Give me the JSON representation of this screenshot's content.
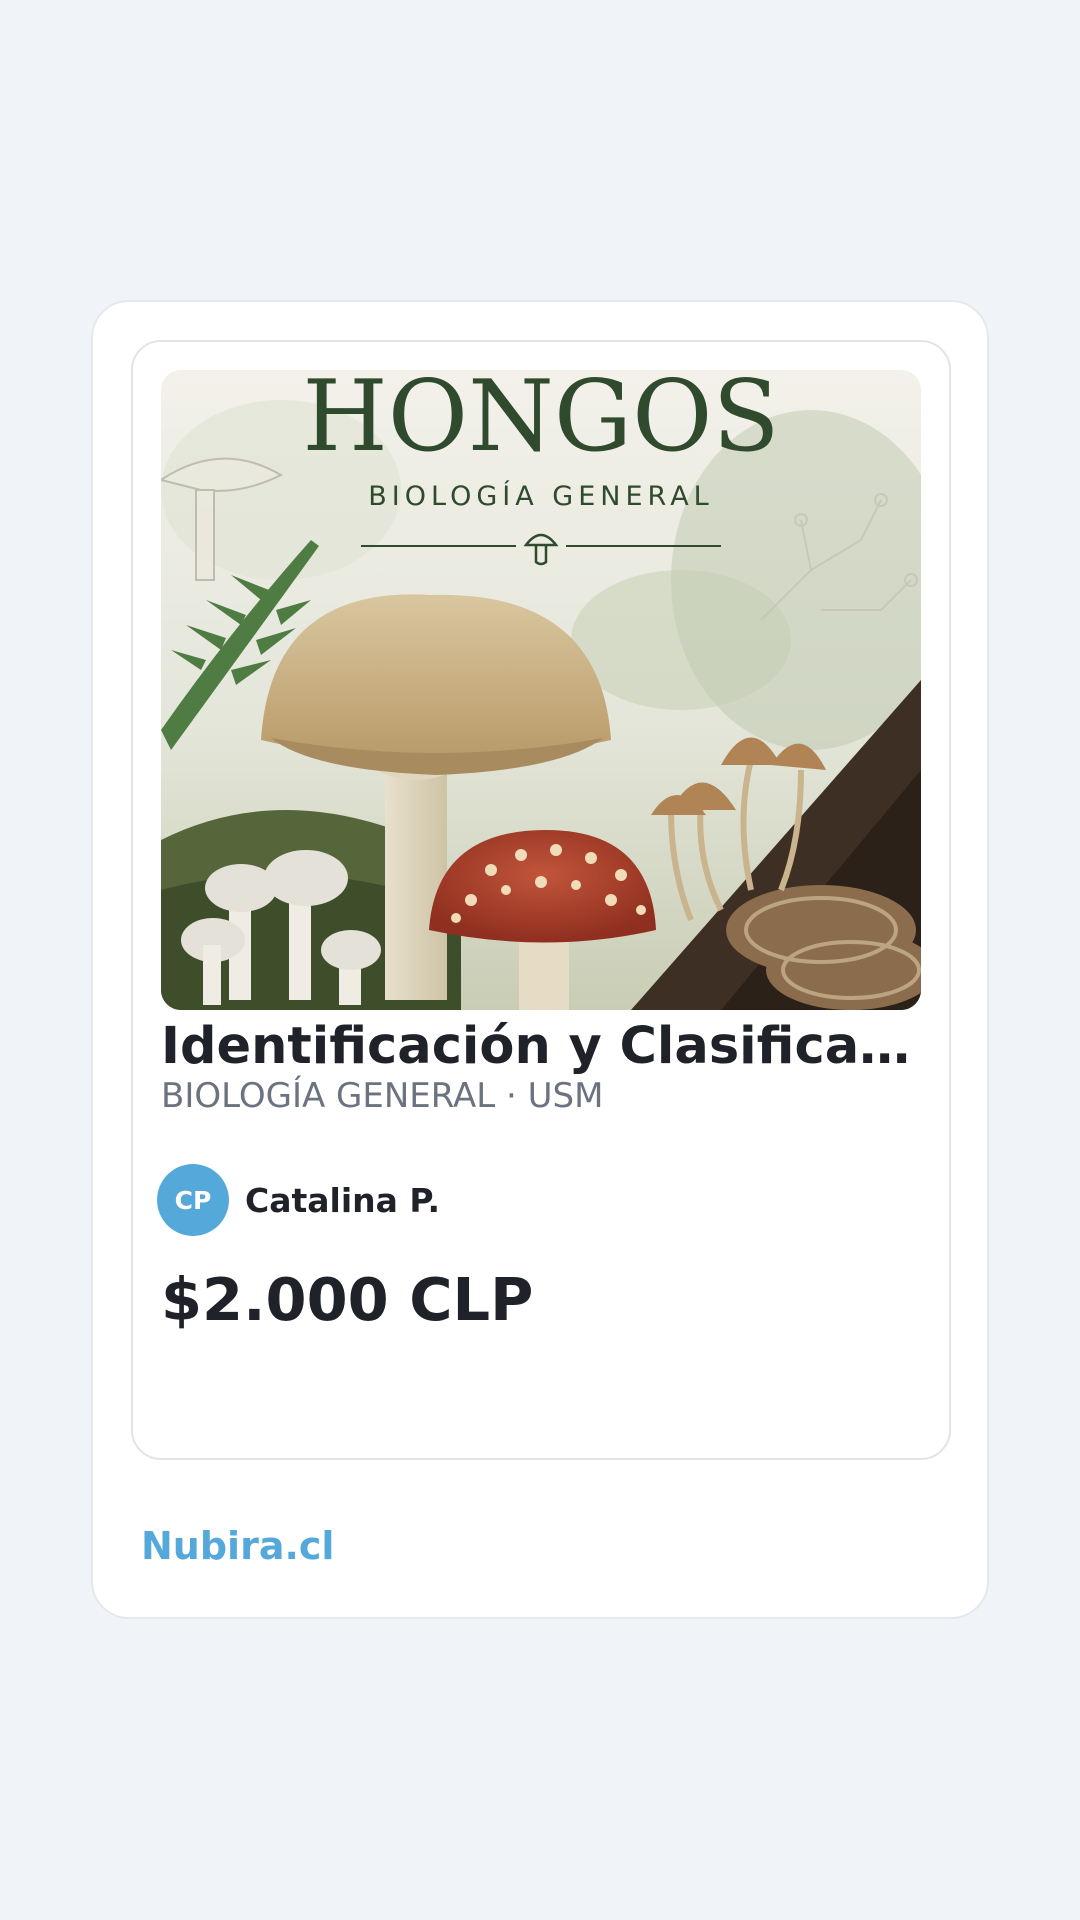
{
  "cover": {
    "title": "HONGOS",
    "subtitle": "BIOLOGÍA GENERAL"
  },
  "product": {
    "title": "Identificación y Clasificación...",
    "meta": "BIOLOGÍA GENERAL · USM",
    "price": "$2.000 CLP"
  },
  "seller": {
    "initials": "CP",
    "name": "Catalina P."
  },
  "brand": {
    "label": "Nubira.cl"
  },
  "colors": {
    "background": "#f0f4f8",
    "accent": "#55a9da",
    "text": "#1f2329",
    "muted": "#6b7280"
  }
}
